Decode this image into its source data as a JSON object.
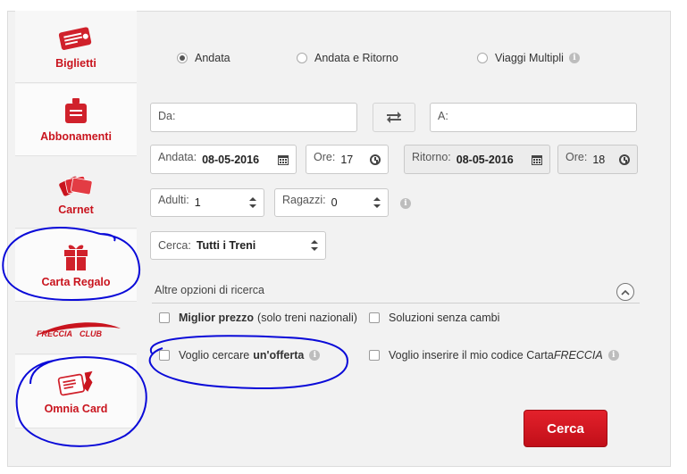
{
  "colors": {
    "accent": "#c9141e",
    "panel": "#f2f2f2",
    "annotation": "#0a0ad8"
  },
  "sidebar": {
    "items": [
      {
        "label": "Biglietti",
        "icon": "ticket-icon",
        "active": true
      },
      {
        "label": "Abbonamenti",
        "icon": "badge-icon",
        "active": false
      },
      {
        "label": "Carnet",
        "icon": "cards-icon",
        "active": false
      },
      {
        "label": "Carta Regalo",
        "icon": "gift-icon",
        "active": false
      },
      {
        "label": "FRECCIA CLUB",
        "icon": "frecciaclub-logo",
        "active": false
      },
      {
        "label": "Omnia Card",
        "icon": "omnia-card-icon",
        "active": false
      }
    ]
  },
  "trip_type": {
    "options": [
      {
        "label": "Andata",
        "selected": true
      },
      {
        "label": "Andata e Ritorno",
        "selected": false
      },
      {
        "label": "Viaggi Multipli",
        "selected": false,
        "info": "i"
      }
    ]
  },
  "form": {
    "from_label": "Da:",
    "to_label": "A:",
    "andata_label": "Andata:",
    "andata_value": "08-05-2016",
    "ore1_label": "Ore:",
    "ore1_value": "17",
    "ritorno_label": "Ritorno:",
    "ritorno_value": "08-05-2016",
    "ore2_label": "Ore:",
    "ore2_value": "18",
    "adulti_label": "Adulti:",
    "adulti_value": "1",
    "ragazzi_label": "Ragazzi:",
    "ragazzi_value": "0",
    "cerca_label": "Cerca:",
    "cerca_value": "Tutti i Treni",
    "info": "i"
  },
  "options": {
    "title": "Altre opzioni di ricerca",
    "miglior_prezzo_bold": "Miglior prezzo",
    "miglior_prezzo_rest": "(solo treni nazionali)",
    "soluzioni": "Soluzioni senza cambi",
    "offerta_pre": "Voglio cercare",
    "offerta_bold": "un'offerta",
    "codice_pre": "Voglio inserire il mio codice Carta",
    "codice_italic": "FRECCIA"
  },
  "search_button": "Cerca"
}
